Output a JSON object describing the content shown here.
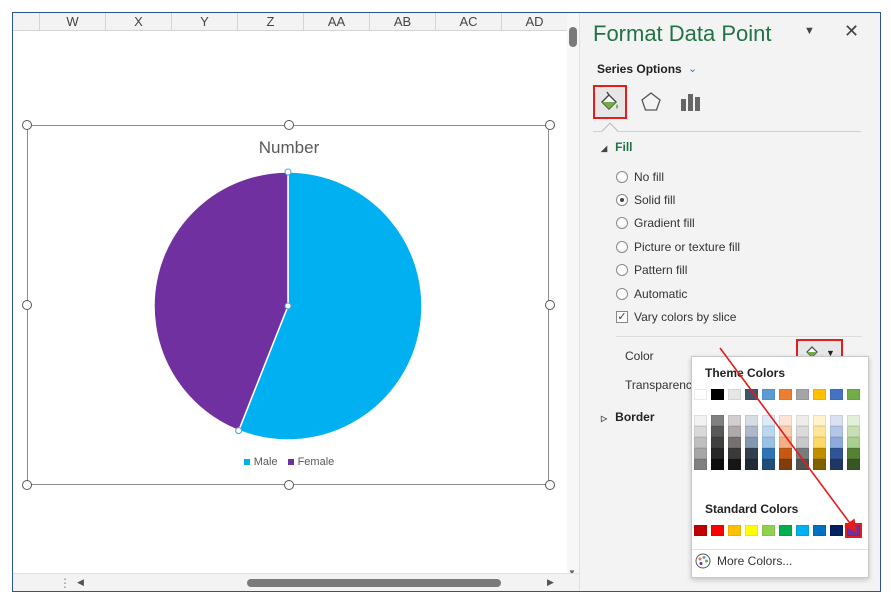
{
  "sheet": {
    "columns": [
      "W",
      "X",
      "Y",
      "Z",
      "AA",
      "AB",
      "AC",
      "AD"
    ]
  },
  "chart_data": {
    "type": "pie",
    "title": "Number",
    "categories": [
      "Male",
      "Female"
    ],
    "values": [
      56,
      44
    ],
    "colors": [
      "#00b0f0",
      "#7030a0"
    ],
    "legend": "bottom"
  },
  "pane": {
    "title": "Format Data Point",
    "series_options": "Series Options",
    "fill_header": "Fill",
    "fill_options": [
      "No fill",
      "Solid fill",
      "Gradient fill",
      "Picture or texture fill",
      "Pattern fill",
      "Automatic"
    ],
    "selected_fill": "Solid fill",
    "vary_colors": "Vary colors by slice",
    "color_label": "Color",
    "transparency_label": "Transparency",
    "border_header": "Border"
  },
  "popup": {
    "theme_title": "Theme Colors",
    "standard_title": "Standard Colors",
    "more_colors": "More Colors...",
    "theme_top": [
      "#ffffff",
      "#000000",
      "#e7e6e6",
      "#44546a",
      "#5b9bd5",
      "#ed7d31",
      "#a5a5a5",
      "#ffc000",
      "#4472c4",
      "#70ad47"
    ],
    "theme_shades": [
      [
        "#f2f2f2",
        "#d9d9d9",
        "#bfbfbf",
        "#a6a6a6",
        "#808080"
      ],
      [
        "#808080",
        "#595959",
        "#404040",
        "#262626",
        "#0d0d0d"
      ],
      [
        "#d0cece",
        "#aeaaaa",
        "#757171",
        "#3a3838",
        "#171616"
      ],
      [
        "#d6dce4",
        "#adb9ca",
        "#8497b0",
        "#333f4f",
        "#222a35"
      ],
      [
        "#ddebf7",
        "#bdd7ee",
        "#9bc2e6",
        "#2f75b5",
        "#1f4e78"
      ],
      [
        "#fce4d6",
        "#f8cbad",
        "#f4b084",
        "#c65911",
        "#833c0c"
      ],
      [
        "#ededed",
        "#dbdbdb",
        "#c9c9c9",
        "#7b7b7b",
        "#525252"
      ],
      [
        "#fff2cc",
        "#ffe699",
        "#ffd966",
        "#bf8f00",
        "#806000"
      ],
      [
        "#d9e1f2",
        "#b4c6e7",
        "#8ea9db",
        "#305496",
        "#203764"
      ],
      [
        "#e2efda",
        "#c6e0b4",
        "#a9d08e",
        "#548235",
        "#375623"
      ]
    ],
    "standard": [
      "#c00000",
      "#ff0000",
      "#ffc000",
      "#ffff00",
      "#92d050",
      "#00b050",
      "#00b0f0",
      "#0070c0",
      "#002060",
      "#7030a0"
    ],
    "selected_standard": "#7030a0"
  }
}
